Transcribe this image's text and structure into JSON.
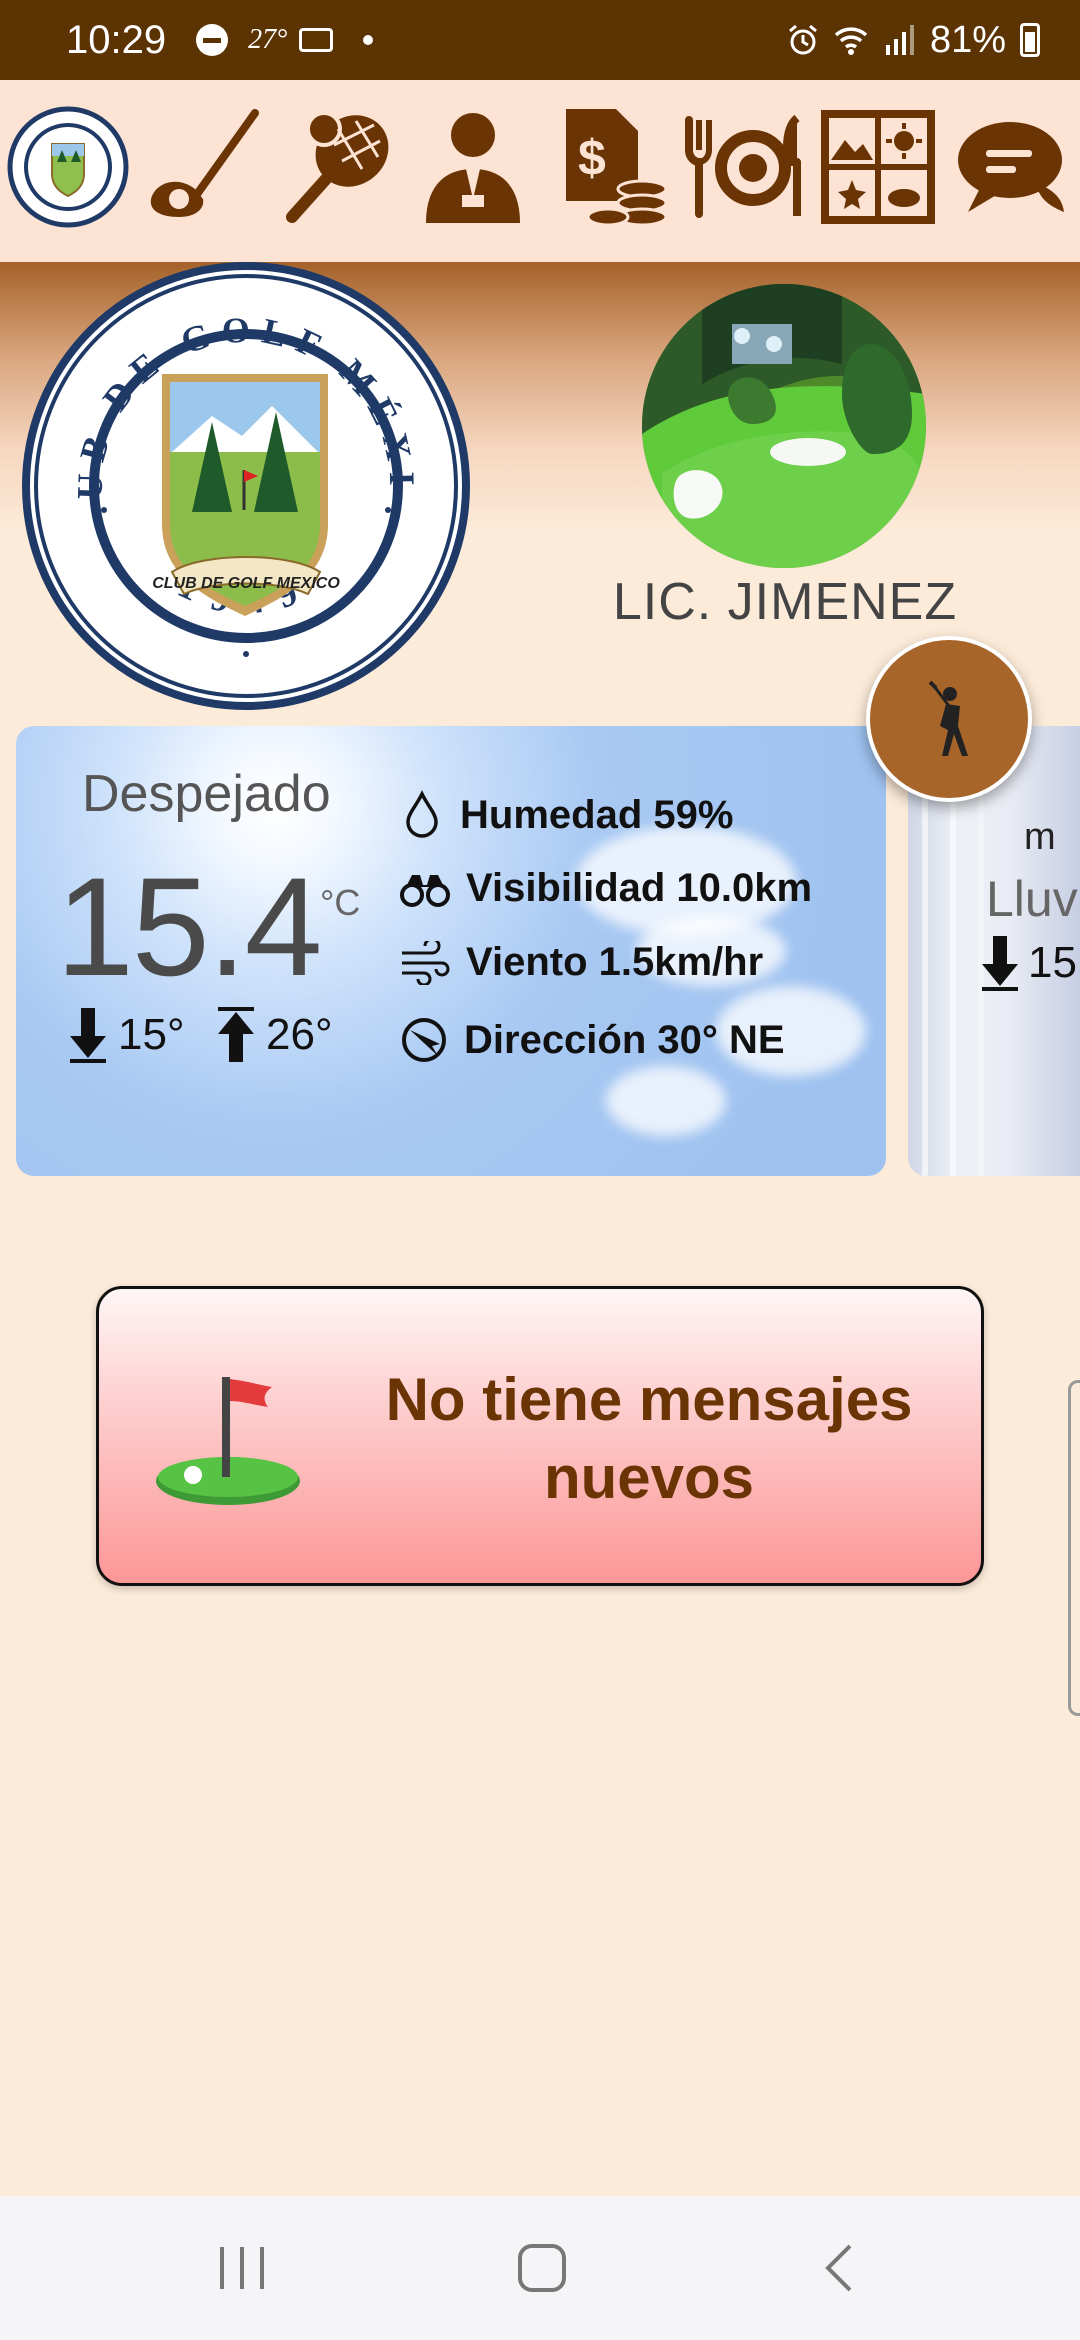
{
  "status_bar": {
    "time": "10:29",
    "temperature": "27°",
    "battery": "81%"
  },
  "top_nav": {
    "items": [
      {
        "icon": "club-logo-icon"
      },
      {
        "icon": "golf-club-icon"
      },
      {
        "icon": "tennis-racket-icon"
      },
      {
        "icon": "staff-person-icon"
      },
      {
        "icon": "billing-invoice-icon"
      },
      {
        "icon": "restaurant-icon"
      },
      {
        "icon": "gallery-icon"
      },
      {
        "icon": "chat-icon"
      }
    ]
  },
  "header": {
    "logo_text_top": "CLUB DE GOLF MÉXICO",
    "logo_year": "1949",
    "logo_shield_text": "CLUB DE GOLF MEXICO",
    "user_name": "LIC. JIMENEZ"
  },
  "weather": {
    "condition": "Despejado",
    "temperature": "15.4",
    "unit": "°C",
    "min": "15°",
    "max": "26°",
    "humidity": "Humedad 59%",
    "visibility": "Visibilidad 10.0km",
    "wind": "Viento 1.5km/hr",
    "direction": "Dirección 30° NE"
  },
  "weather_next": {
    "label_partial": "m",
    "condition_partial": "Lluv",
    "min_partial": "15"
  },
  "messages": {
    "empty_text": "No tiene mensajes nuevos"
  },
  "colors": {
    "brand_brown": "#5c3303",
    "nav_icon": "#6a3404",
    "background": "#fcebd9"
  }
}
